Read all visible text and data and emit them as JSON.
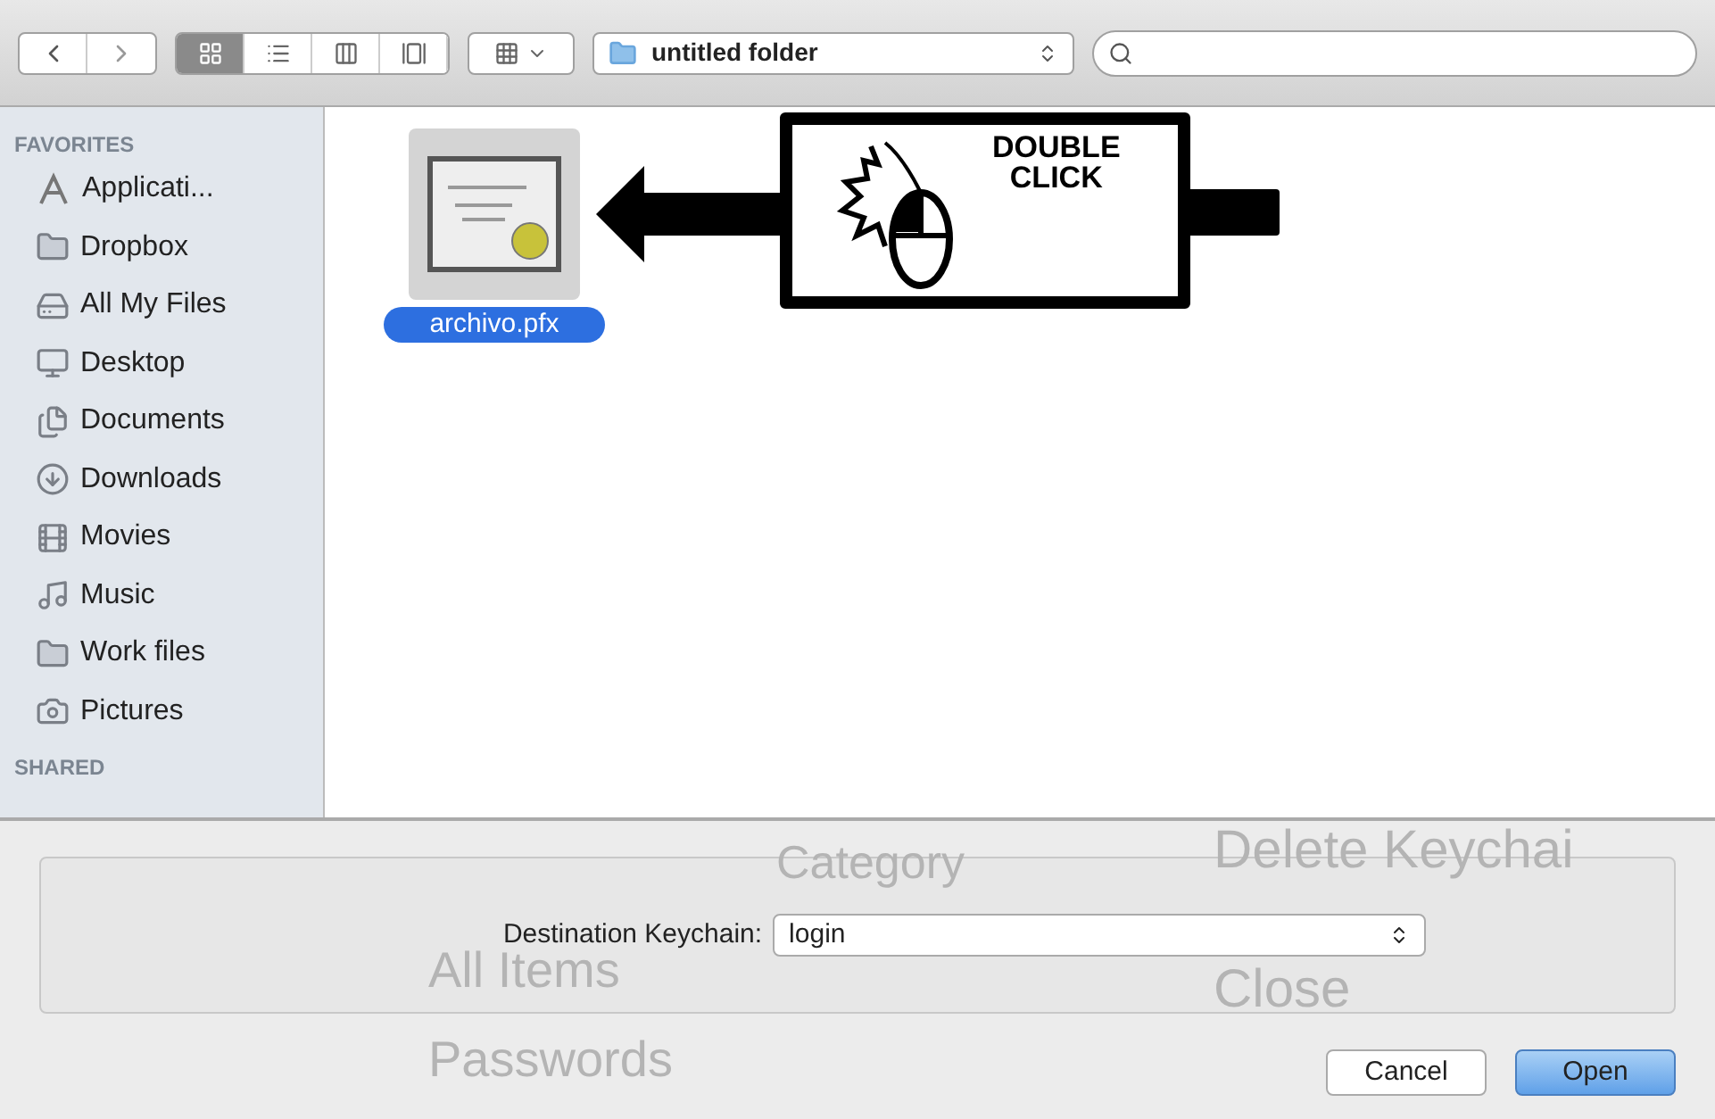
{
  "toolbar": {
    "view_modes": [
      {
        "kind": "icons",
        "selected": true
      },
      {
        "kind": "list",
        "selected": false
      },
      {
        "kind": "columns",
        "selected": false
      },
      {
        "kind": "coverflow",
        "selected": false
      }
    ],
    "location": "untitled folder"
  },
  "sidebar": {
    "sections": [
      {
        "title": "FAVORITES",
        "items": [
          {
            "label": "Applicati...",
            "kind": "apps"
          },
          {
            "label": "Dropbox",
            "kind": "folder"
          },
          {
            "label": "All My Files",
            "kind": "files"
          },
          {
            "label": "Desktop",
            "kind": "desktop"
          },
          {
            "label": "Documents",
            "kind": "documents"
          },
          {
            "label": "Downloads",
            "kind": "downloads"
          },
          {
            "label": "Movies",
            "kind": "movies"
          },
          {
            "label": "Music",
            "kind": "music"
          },
          {
            "label": "Work files",
            "kind": "folder"
          },
          {
            "label": "Pictures",
            "kind": "pictures"
          }
        ]
      },
      {
        "title": "SHARED"
      }
    ]
  },
  "files": [
    {
      "name": "archivo.pfx",
      "selected": true
    }
  ],
  "annotation": {
    "lines": [
      "DOUBLE",
      "CLICK"
    ]
  },
  "background_window": {
    "texts": [
      "Category",
      "All Items",
      "Passwords",
      "Delete Keychai",
      "Close"
    ]
  },
  "keychain": {
    "label": "Destination Keychain:",
    "value": "login"
  },
  "buttons": [
    {
      "label": "Cancel",
      "default": false
    },
    {
      "label": "Open",
      "default": true
    }
  ]
}
